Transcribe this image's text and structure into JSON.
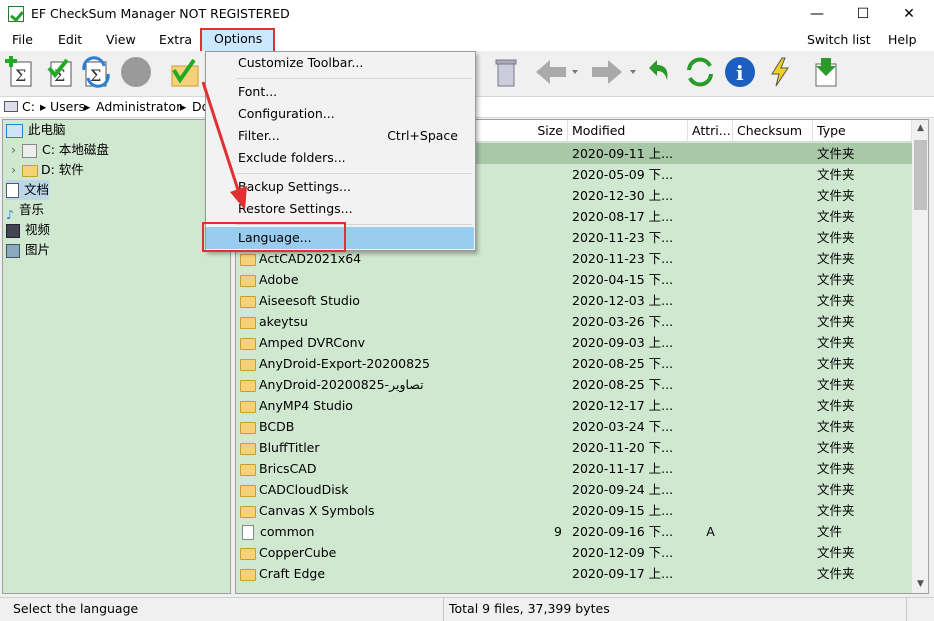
{
  "window": {
    "title": "EF CheckSum Manager NOT REGISTERED",
    "minimize": "—",
    "maximize": "☐",
    "close": "✕"
  },
  "menubar": {
    "items": [
      "File",
      "Edit",
      "View",
      "Extra",
      "Options"
    ],
    "right_items": [
      "Switch list",
      "Help"
    ]
  },
  "toolbar": {
    "icons": [
      "create-checksum-icon",
      "verify-checksum-icon",
      "update-checksum-icon",
      "stop-icon",
      "check-folder-icon",
      "recycle-bin-icon",
      "back-icon",
      "forward-icon",
      "undo-icon",
      "refresh-icon",
      "info-icon",
      "lightning-icon",
      "download-icon"
    ]
  },
  "pathbar": {
    "segments": [
      "C:",
      "Users",
      "Administrator",
      "Do"
    ]
  },
  "tree": {
    "items": [
      {
        "label": "此电脑",
        "icon": "computer-icon"
      },
      {
        "label": "C: 本地磁盘",
        "icon": "drive-icon"
      },
      {
        "label": "D: 软件",
        "icon": "folder-icon"
      },
      {
        "label": "文档",
        "icon": "documents-icon"
      },
      {
        "label": "音乐",
        "icon": "music-icon"
      },
      {
        "label": "视频",
        "icon": "video-icon"
      },
      {
        "label": "图片",
        "icon": "pictures-icon"
      }
    ]
  },
  "filelist": {
    "columns": [
      "Size",
      "Modified",
      "Attri...",
      "Checksum",
      "Type"
    ],
    "rows": [
      {
        "name": "",
        "size": "",
        "modified": "2020-09-11  上...",
        "attr": "",
        "checksum": "",
        "type": "文件夹",
        "kind": "folder"
      },
      {
        "name": "",
        "size": "",
        "modified": "2020-05-09  下...",
        "attr": "",
        "checksum": "",
        "type": "文件夹",
        "kind": "folder"
      },
      {
        "name": "",
        "size": "",
        "modified": "2020-12-30  上...",
        "attr": "",
        "checksum": "",
        "type": "文件夹",
        "kind": "folder"
      },
      {
        "name": "",
        "size": "",
        "modified": "2020-08-17  上...",
        "attr": "",
        "checksum": "",
        "type": "文件夹",
        "kind": "folder"
      },
      {
        "name": "",
        "size": "",
        "modified": "2020-11-23  下...",
        "attr": "",
        "checksum": "",
        "type": "文件夹",
        "kind": "folder"
      },
      {
        "name": "ActCAD2021x64",
        "size": "",
        "modified": "2020-11-23  下...",
        "attr": "",
        "checksum": "",
        "type": "文件夹",
        "kind": "folder"
      },
      {
        "name": "Adobe",
        "size": "",
        "modified": "2020-04-15  下...",
        "attr": "",
        "checksum": "",
        "type": "文件夹",
        "kind": "folder"
      },
      {
        "name": "Aiseesoft Studio",
        "size": "",
        "modified": "2020-12-03  上...",
        "attr": "",
        "checksum": "",
        "type": "文件夹",
        "kind": "folder"
      },
      {
        "name": "akeytsu",
        "size": "",
        "modified": "2020-03-26  下...",
        "attr": "",
        "checksum": "",
        "type": "文件夹",
        "kind": "folder"
      },
      {
        "name": "Amped DVRConv",
        "size": "",
        "modified": "2020-09-03  上...",
        "attr": "",
        "checksum": "",
        "type": "文件夹",
        "kind": "folder"
      },
      {
        "name": "AnyDroid-Export-20200825",
        "size": "",
        "modified": "2020-08-25  下...",
        "attr": "",
        "checksum": "",
        "type": "文件夹",
        "kind": "folder"
      },
      {
        "name": "AnyDroid-20200825-تصاویر",
        "size": "",
        "modified": "2020-08-25  下...",
        "attr": "",
        "checksum": "",
        "type": "文件夹",
        "kind": "folder"
      },
      {
        "name": "AnyMP4 Studio",
        "size": "",
        "modified": "2020-12-17  上...",
        "attr": "",
        "checksum": "",
        "type": "文件夹",
        "kind": "folder"
      },
      {
        "name": "BCDB",
        "size": "",
        "modified": "2020-03-24  下...",
        "attr": "",
        "checksum": "",
        "type": "文件夹",
        "kind": "folder"
      },
      {
        "name": "BluffTitler",
        "size": "",
        "modified": "2020-11-20  下...",
        "attr": "",
        "checksum": "",
        "type": "文件夹",
        "kind": "folder"
      },
      {
        "name": "BricsCAD",
        "size": "",
        "modified": "2020-11-17  上...",
        "attr": "",
        "checksum": "",
        "type": "文件夹",
        "kind": "folder"
      },
      {
        "name": "CADCloudDisk",
        "size": "",
        "modified": "2020-09-24  上...",
        "attr": "",
        "checksum": "",
        "type": "文件夹",
        "kind": "folder"
      },
      {
        "name": "Canvas X Symbols",
        "size": "",
        "modified": "2020-09-15  上...",
        "attr": "",
        "checksum": "",
        "type": "文件夹",
        "kind": "folder"
      },
      {
        "name": "common",
        "size": "9",
        "modified": "2020-09-16  下...",
        "attr": "A",
        "checksum": "",
        "type": "文件",
        "kind": "file"
      },
      {
        "name": "CopperCube",
        "size": "",
        "modified": "2020-12-09  下...",
        "attr": "",
        "checksum": "",
        "type": "文件夹",
        "kind": "folder"
      },
      {
        "name": "Craft Edge",
        "size": "",
        "modified": "2020-09-17  上...",
        "attr": "",
        "checksum": "",
        "type": "文件夹",
        "kind": "folder"
      }
    ]
  },
  "options_menu": {
    "items": [
      {
        "label": "Customize Toolbar...",
        "shortcut": ""
      },
      {
        "label": "Font...",
        "shortcut": ""
      },
      {
        "label": "Configuration...",
        "shortcut": ""
      },
      {
        "label": "Filter...",
        "shortcut": "Ctrl+Space"
      },
      {
        "label": "Exclude folders...",
        "shortcut": ""
      },
      {
        "label": "Backup Settings...",
        "shortcut": ""
      },
      {
        "label": "Restore Settings...",
        "shortcut": ""
      },
      {
        "label": "Language...",
        "shortcut": ""
      }
    ]
  },
  "statusbar": {
    "hint": "Select the language",
    "summary": "Total 9 files, 37,399 bytes"
  },
  "colors": {
    "list_background": "#cfe8cf",
    "selected_row": "#a8c8a8",
    "highlight_border": "#e03030",
    "menu_hover": "#99ccee"
  }
}
